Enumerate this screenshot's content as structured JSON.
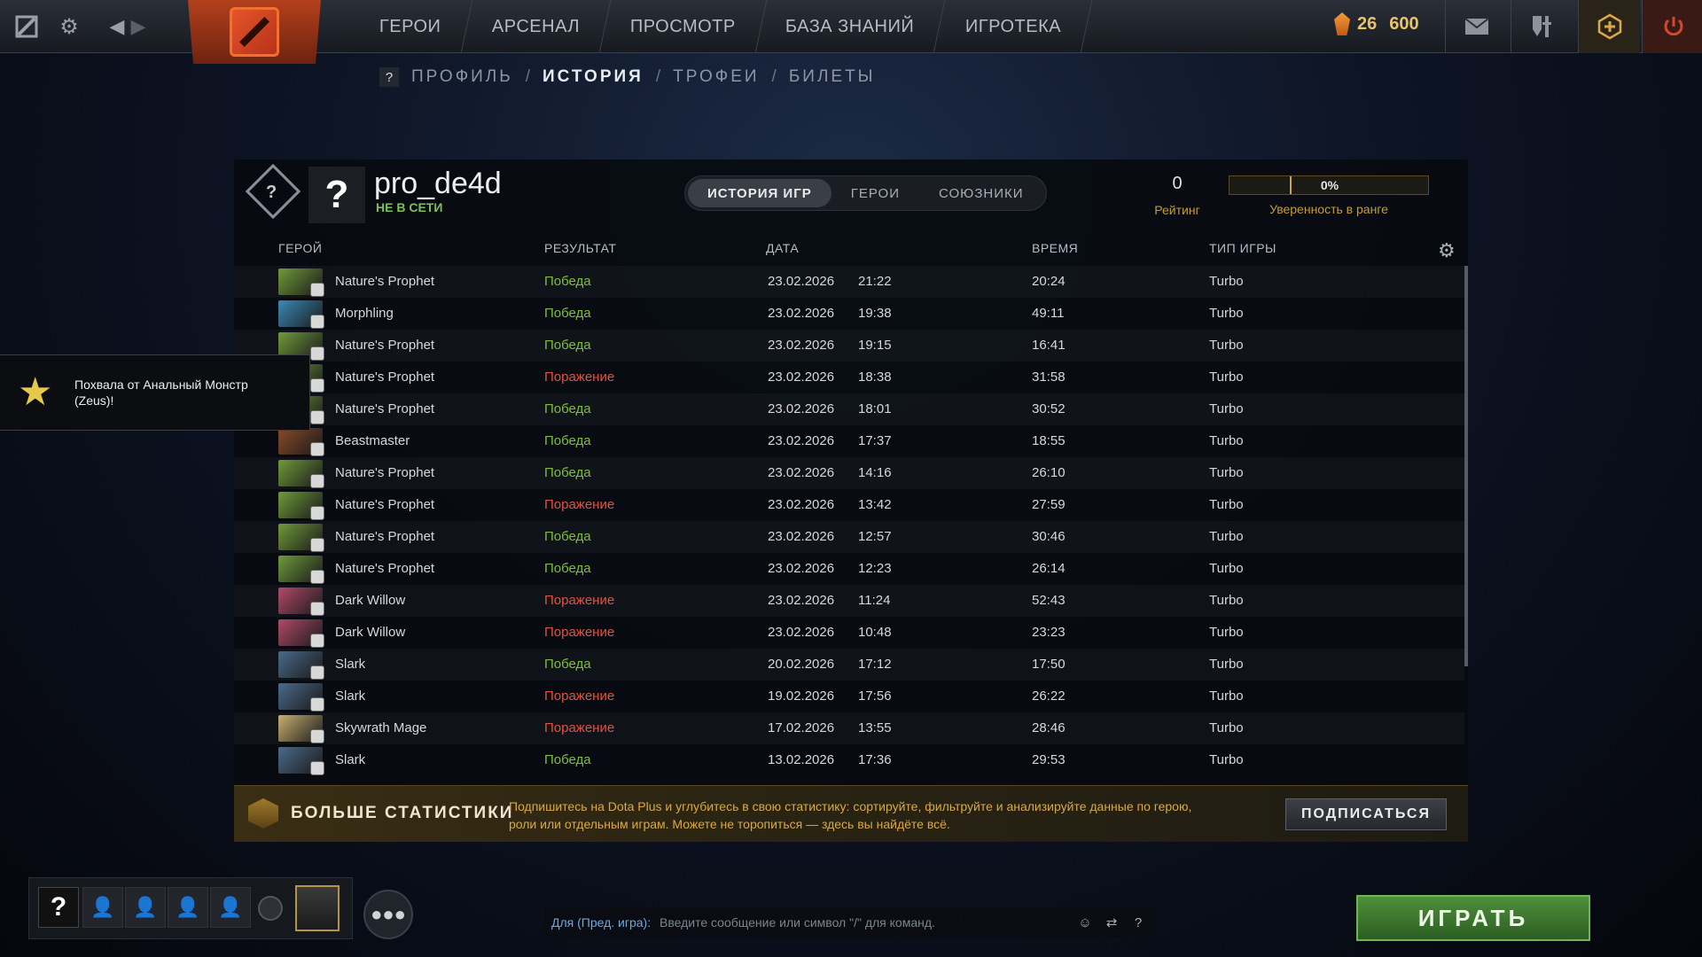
{
  "topbar": {
    "nav": [
      "ГЕРОИ",
      "АРСЕНАЛ",
      "ПРОСМОТР",
      "БАЗА ЗНАНИЙ",
      "ИГРОТЕКА"
    ],
    "currency": {
      "level": "26",
      "shards": "600"
    }
  },
  "breadcrumb": {
    "help": "?",
    "items": [
      "ПРОФИЛЬ",
      "ИСТОРИЯ",
      "ТРОФЕИ",
      "БИЛЕТЫ"
    ],
    "separator": "/",
    "active": "ИСТОРИЯ"
  },
  "profile": {
    "rank_symbol": "?",
    "avatar_symbol": "?",
    "username": "pro_de4d",
    "status": "НЕ В СЕТИ",
    "tabs": [
      "ИСТОРИЯ ИГР",
      "ГЕРОИ",
      "СОЮЗНИКИ"
    ],
    "active_tab": "ИСТОРИЯ ИГР",
    "rating_value": "0",
    "rating_label": "Рейтинг",
    "confidence_value": "0%",
    "confidence_label": "Уверенность в ранге"
  },
  "table": {
    "columns": {
      "hero": "ГЕРОЙ",
      "result": "РЕЗУЛЬТАТ",
      "date": "ДАТА",
      "duration": "ВРЕМЯ",
      "mode": "ТИП ИГРЫ"
    },
    "rows": [
      {
        "hero": "Nature's Prophet",
        "result": "Победа",
        "win": true,
        "date": "23.02.2026",
        "time": "21:22",
        "duration": "20:24",
        "mode": "Turbo",
        "color": "#6f9a3a"
      },
      {
        "hero": "Morphling",
        "result": "Победа",
        "win": true,
        "date": "23.02.2026",
        "time": "19:38",
        "duration": "49:11",
        "mode": "Turbo",
        "color": "#3a8ab8"
      },
      {
        "hero": "Nature's Prophet",
        "result": "Победа",
        "win": true,
        "date": "23.02.2026",
        "time": "19:15",
        "duration": "16:41",
        "mode": "Turbo",
        "color": "#6f9a3a"
      },
      {
        "hero": "Nature's Prophet",
        "result": "Поражение",
        "win": false,
        "date": "23.02.2026",
        "time": "18:38",
        "duration": "31:58",
        "mode": "Turbo",
        "color": "#6f9a3a"
      },
      {
        "hero": "Nature's Prophet",
        "result": "Победа",
        "win": true,
        "date": "23.02.2026",
        "time": "18:01",
        "duration": "30:52",
        "mode": "Turbo",
        "color": "#6f9a3a"
      },
      {
        "hero": "Beastmaster",
        "result": "Победа",
        "win": true,
        "date": "23.02.2026",
        "time": "17:37",
        "duration": "18:55",
        "mode": "Turbo",
        "color": "#8a4a2a"
      },
      {
        "hero": "Nature's Prophet",
        "result": "Победа",
        "win": true,
        "date": "23.02.2026",
        "time": "14:16",
        "duration": "26:10",
        "mode": "Turbo",
        "color": "#6f9a3a"
      },
      {
        "hero": "Nature's Prophet",
        "result": "Поражение",
        "win": false,
        "date": "23.02.2026",
        "time": "13:42",
        "duration": "27:59",
        "mode": "Turbo",
        "color": "#6f9a3a"
      },
      {
        "hero": "Nature's Prophet",
        "result": "Победа",
        "win": true,
        "date": "23.02.2026",
        "time": "12:57",
        "duration": "30:46",
        "mode": "Turbo",
        "color": "#6f9a3a"
      },
      {
        "hero": "Nature's Prophet",
        "result": "Победа",
        "win": true,
        "date": "23.02.2026",
        "time": "12:23",
        "duration": "26:14",
        "mode": "Turbo",
        "color": "#6f9a3a"
      },
      {
        "hero": "Dark Willow",
        "result": "Поражение",
        "win": false,
        "date": "23.02.2026",
        "time": "11:24",
        "duration": "52:43",
        "mode": "Turbo",
        "color": "#b04a6a"
      },
      {
        "hero": "Dark Willow",
        "result": "Поражение",
        "win": false,
        "date": "23.02.2026",
        "time": "10:48",
        "duration": "23:23",
        "mode": "Turbo",
        "color": "#b04a6a"
      },
      {
        "hero": "Slark",
        "result": "Победа",
        "win": true,
        "date": "20.02.2026",
        "time": "17:12",
        "duration": "17:50",
        "mode": "Turbo",
        "color": "#4a6a8a"
      },
      {
        "hero": "Slark",
        "result": "Поражение",
        "win": false,
        "date": "19.02.2026",
        "time": "17:56",
        "duration": "26:22",
        "mode": "Turbo",
        "color": "#4a6a8a"
      },
      {
        "hero": "Skywrath Mage",
        "result": "Поражение",
        "win": false,
        "date": "17.02.2026",
        "time": "13:55",
        "duration": "28:46",
        "mode": "Turbo",
        "color": "#c8b070"
      },
      {
        "hero": "Slark",
        "result": "Победа",
        "win": true,
        "date": "13.02.2026",
        "time": "17:36",
        "duration": "29:53",
        "mode": "Turbo",
        "color": "#4a6a8a"
      }
    ]
  },
  "promo": {
    "title": "БОЛЬШЕ СТАТИСТИКИ",
    "text": "Подпишитесь на Dota Plus и углубитесь в свою статистику: сортируйте, фильтруйте и анализируйте данные по герою, роли или отдельным играм. Можете не торопиться — здесь вы найдёте всё.",
    "button": "ПОДПИСАТЬСЯ"
  },
  "notification": {
    "text": "Похвала от Анальный Монстр (Zeus)!"
  },
  "party": {
    "me_symbol": "?"
  },
  "chat": {
    "channel": "Для (Пред. игра):",
    "placeholder": "Введите сообщение или символ \"/\" для команд.",
    "help": "?"
  },
  "play_button": "ИГРАТЬ",
  "colors": {
    "win": "#7fbe3b",
    "loss": "#e0533f",
    "accent": "#c79a3c",
    "play": "#4f8f3a"
  }
}
